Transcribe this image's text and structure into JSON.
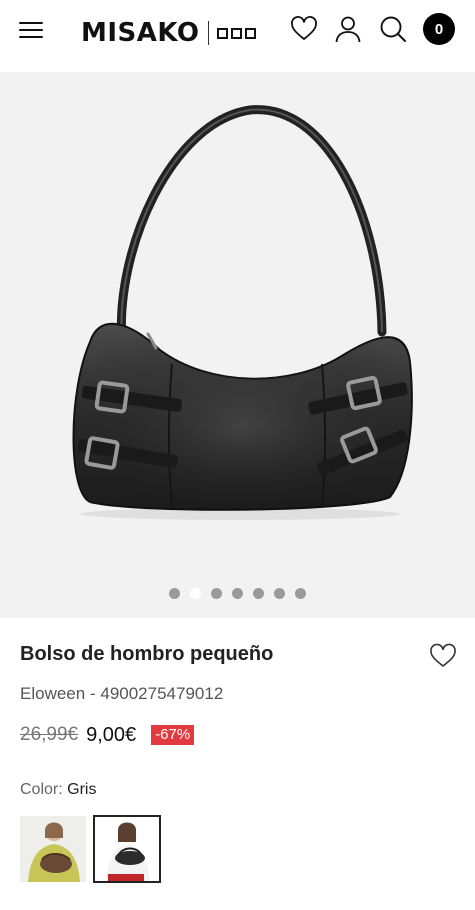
{
  "header": {
    "logo_text": "MISAKO",
    "cart_count": "0",
    "icons": [
      "menu-icon",
      "heart-icon",
      "user-icon",
      "search-icon",
      "cart-badge"
    ]
  },
  "gallery": {
    "image_count": 7,
    "active_index": 1,
    "image_subject": "black leather shoulder bag with buckles"
  },
  "product": {
    "title": "Bolso de hombro pequeño",
    "brand": "Eloween",
    "separator": "-",
    "reference": "4900275479012",
    "old_price": "26,99€",
    "new_price": "9,00€",
    "discount": "-67%",
    "color_label": "Color:",
    "color_value": "Gris",
    "swatches": [
      {
        "name": "Marrón",
        "selected": false
      },
      {
        "name": "Gris",
        "selected": true
      }
    ]
  },
  "colors": {
    "discount_bg": "#e23a40",
    "gallery_bg": "#f2f2f2",
    "dot_inactive": "#9a9a9a",
    "dot_active": "#ffffff"
  }
}
